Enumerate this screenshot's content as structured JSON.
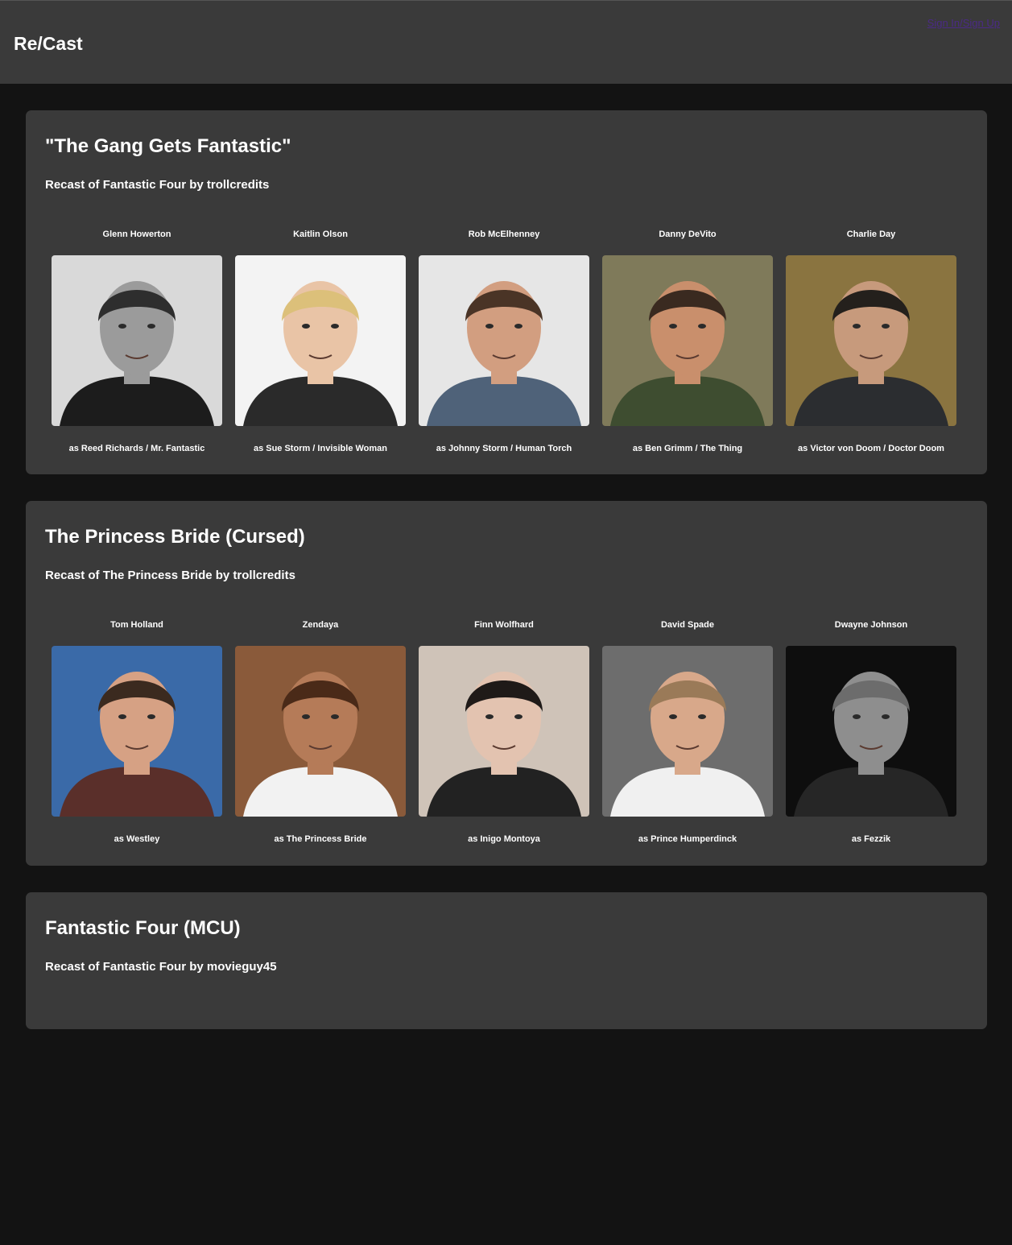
{
  "app": {
    "title": "Re/Cast",
    "auth_link_label": "Sign In/Sign Up"
  },
  "recasts": [
    {
      "title": "\"The Gang Gets Fantastic\"",
      "subtitle": "Recast of Fantastic Four by trollcredits",
      "cast": [
        {
          "actor": "Glenn Howerton",
          "role": "as Reed Richards / Mr. Fantastic",
          "photo_bg": "#d9d9d9",
          "photo_skin": "#9b9b9b",
          "photo_hair": "#2e2e2e",
          "photo_shirt": "#1c1c1c"
        },
        {
          "actor": "Kaitlin Olson",
          "role": "as Sue Storm / Invisible Woman",
          "photo_bg": "#f3f3f3",
          "photo_skin": "#e9c4a6",
          "photo_hair": "#dcc07a",
          "photo_shirt": "#2a2a2a"
        },
        {
          "actor": "Rob McElhenney",
          "role": "as Johnny Storm / Human Torch",
          "photo_bg": "#e6e6e6",
          "photo_skin": "#d29e80",
          "photo_hair": "#4a3426",
          "photo_shirt": "#4f6279"
        },
        {
          "actor": "Danny DeVito",
          "role": "as Ben Grimm / The Thing",
          "photo_bg": "#7f7a5a",
          "photo_skin": "#c98f6c",
          "photo_hair": "#3a2a20",
          "photo_shirt": "#3e4d30"
        },
        {
          "actor": "Charlie Day",
          "role": "as Victor von Doom / Doctor Doom",
          "photo_bg": "#8a7440",
          "photo_skin": "#c79a7c",
          "photo_hair": "#24201c",
          "photo_shirt": "#2b2d30"
        }
      ]
    },
    {
      "title": "The Princess Bride (Cursed)",
      "subtitle": "Recast of The Princess Bride by trollcredits",
      "cast": [
        {
          "actor": "Tom Holland",
          "role": "as Westley",
          "photo_bg": "#3a6aa8",
          "photo_skin": "#d6a184",
          "photo_hair": "#3b2a1f",
          "photo_shirt": "#5a2f2a"
        },
        {
          "actor": "Zendaya",
          "role": "as The Princess Bride",
          "photo_bg": "#8a5a3a",
          "photo_skin": "#b57b58",
          "photo_hair": "#4a2a18",
          "photo_shirt": "#f2f2f2"
        },
        {
          "actor": "Finn Wolfhard",
          "role": "as Inigo Montoya",
          "photo_bg": "#cfc3b8",
          "photo_skin": "#e3c3b0",
          "photo_hair": "#1f1a18",
          "photo_shirt": "#222222"
        },
        {
          "actor": "David Spade",
          "role": "as Prince Humperdinck",
          "photo_bg": "#6d6d6d",
          "photo_skin": "#d8a88a",
          "photo_hair": "#9a7a58",
          "photo_shirt": "#f0f0f0"
        },
        {
          "actor": "Dwayne Johnson",
          "role": "as Fezzik",
          "photo_bg": "#0e0e0e",
          "photo_skin": "#8e8e8e",
          "photo_hair": "#6c6c6c",
          "photo_shirt": "#262626"
        }
      ]
    },
    {
      "title": "Fantastic Four (MCU)",
      "subtitle": "Recast of Fantastic Four by movieguy45",
      "cast": []
    }
  ]
}
